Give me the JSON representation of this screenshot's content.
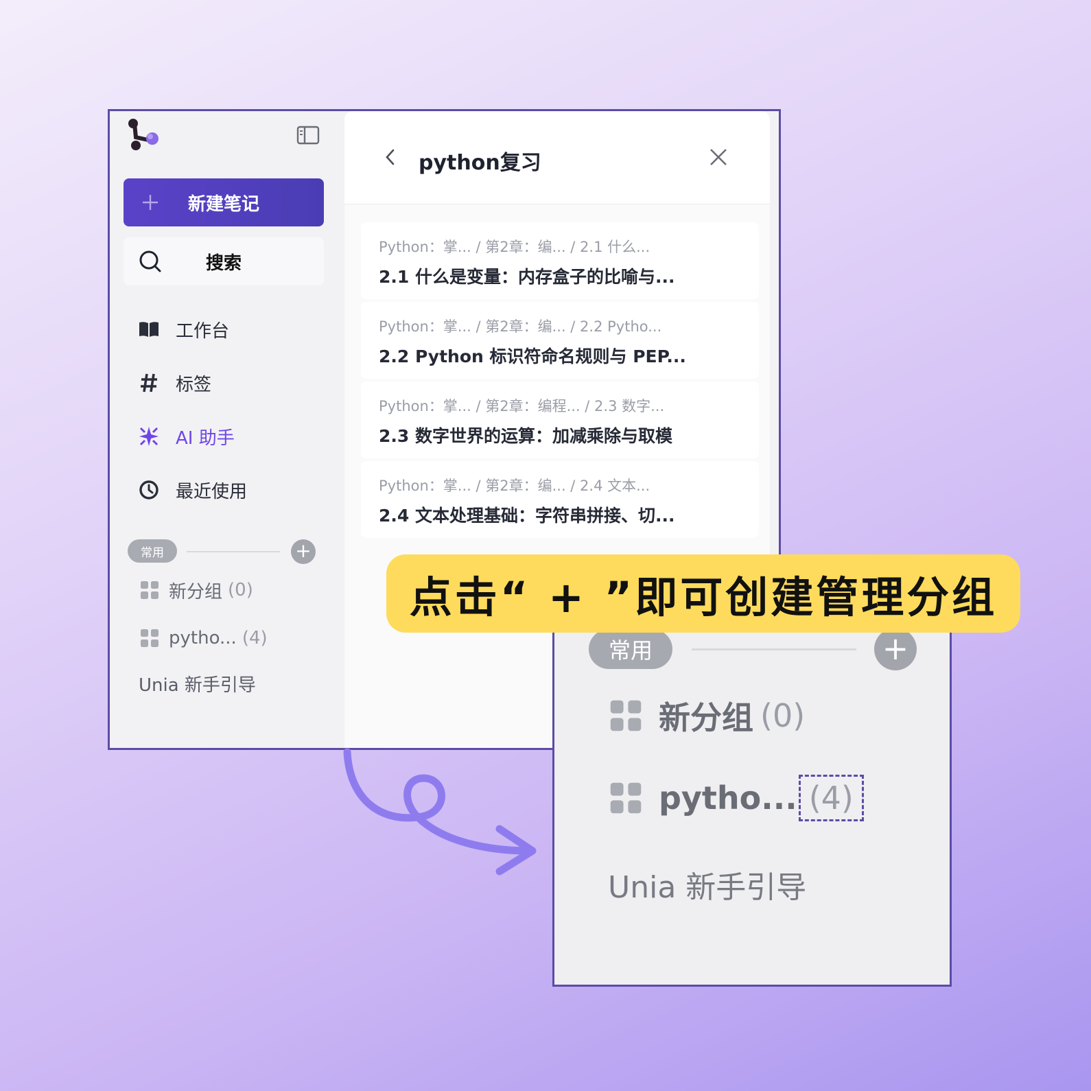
{
  "sidebar": {
    "new_note": "新建笔记",
    "search": "搜索",
    "nav": [
      {
        "label": "工作台",
        "icon": "book-icon"
      },
      {
        "label": "标签",
        "icon": "hash-icon"
      },
      {
        "label": "AI 助手",
        "icon": "sparkle-icon"
      },
      {
        "label": "最近使用",
        "icon": "clock-icon"
      }
    ],
    "group_pill": "常用",
    "groups": [
      {
        "name": "新分组",
        "count": "(0)"
      },
      {
        "name": "pytho...",
        "count": "(4)"
      }
    ],
    "guide": "Unia 新手引导"
  },
  "panel": {
    "title": "python复习",
    "notes": [
      {
        "crumbs": "Python：掌...  / 第2章：编...   / 2.1 什么...",
        "title": "2.1 什么是变量：内存盒子的比喻与..."
      },
      {
        "crumbs": "Python：掌...  / 第2章：编...   / 2.2 Pytho...",
        "title": "2.2 Python 标识符命名规则与 PEP..."
      },
      {
        "crumbs": "Python：掌...  / 第2章：编程... / 2.3 数字...",
        "title": "2.3 数字世界的运算：加减乘除与取模"
      },
      {
        "crumbs": "Python：掌...  / 第2章：编...   / 2.4 文本...",
        "title": "2.4 文本处理基础：字符串拼接、切..."
      }
    ]
  },
  "callout": "点击“ + ”即可创建管理分组",
  "zoom": {
    "pill": "常用",
    "groups": [
      {
        "name": "新分组",
        "count": "(0)"
      },
      {
        "name": "pytho...",
        "count": "(4)"
      }
    ],
    "guide": "Unia 新手引导"
  },
  "colors": {
    "accent": "#5a42c8",
    "ai_purple": "#6f45e8",
    "callout_yellow": "#fedb5c",
    "frame": "#5b4ca6"
  }
}
